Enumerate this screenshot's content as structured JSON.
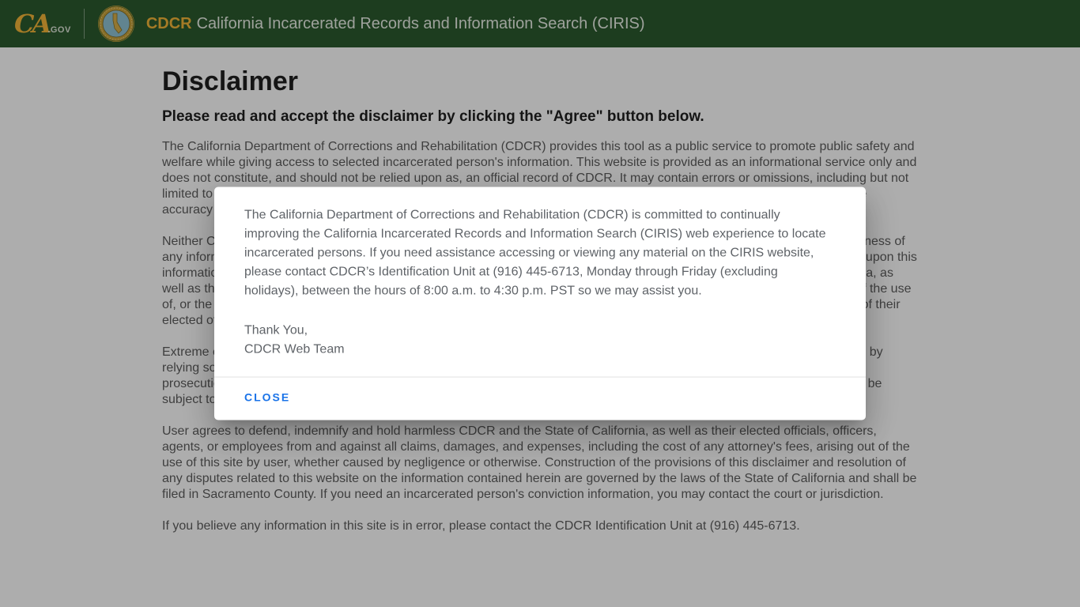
{
  "header": {
    "logo_ca": "CA",
    "logo_gov": ".GOV",
    "brand_cdcr": "CDCR",
    "brand_title": "California Incarcerated Records and Information Search (CIRIS)"
  },
  "colors": {
    "header_green": "#2c5a2e",
    "brand_gold": "#f4b639",
    "close_blue": "#1a73e8",
    "body_text_gray": "#5d5d5d",
    "modal_text_gray": "#5f6368"
  },
  "main": {
    "title": "Disclaimer",
    "subtitle": "Please read and accept the disclaimer by clicking the \"Agree\" button below.",
    "paragraphs": [
      "The California Department of Corrections and Rehabilitation (CDCR) provides this tool as a public service to promote public safety and welfare while giving access to selected incarcerated person's information. This website is provided as an informational service only and does not constitute, and should not be relied upon as, an official record of CDCR. It may contain errors or omissions, including but not limited to an incarcerated person's conviction county, admitted date and current location. CDCR makes no guarantee as to the accuracy or completeness of the information contained in this website.",
      "Neither CDCR nor the State of California assumes any liability or legal responsibility for the accuracy, completeness, or usefulness of any information provided on this website. The user shall assume all risks associated with the use of this website. Any reliance upon this information, made at the sole judgment of the user, may be incorrect, incomplete or outdated. CDCR and the State of California, as well as their elected officials, officers, agents, or employees, shall not be liable for any direct or indirect damages arising out of the use of, or the inability to use, this website. The user waives any and all claims against CDCR and the State of California, and any of their elected officials, officers, agents, or employees, arising from use of or reliance upon the information contained in this website.",
      "Extreme care should be used when utilizing the information contained in this website as positive identification cannot be made by relying solely upon names. Misuse of, or reliance upon, any of the information in this website may subject the user to criminal prosecution and/or civil liability.Unauthorized attempts to change the information in this website are strictly prohibited and may be subject to criminal prosecution and/or civil liability.",
      "User agrees to defend, indemnify and hold harmless CDCR and the State of California, as well as their elected officials, officers, agents, or employees from and against all claims, damages, and expenses, including the cost of any attorney's fees, arising out of the use of this site by user, whether caused by negligence or otherwise. Construction of the provisions of this disclaimer and resolution of any disputes related to this website on the information contained herein are governed by the laws of the State of California and shall be filed in Sacramento County. If you need an incarcerated person's conviction information, you may contact the court or jurisdiction.",
      "If you believe any information in this site is in error, please contact the CDCR Identification Unit at (916) 445-6713."
    ]
  },
  "modal": {
    "body": "The California Department of Corrections and Rehabilitation (CDCR) is committed to continually improving the California Incarcerated Records and Information Search (CIRIS) web experience to locate incarcerated persons. If you need assistance accessing or viewing any material on the CIRIS website, please contact CDCR’s Identification Unit at (916) 445-6713, Monday through Friday (excluding holidays), between the hours of 8:00 a.m. to 4:30 p.m. PST so we may assist you.",
    "signoff_line1": "Thank You,",
    "signoff_line2": "CDCR Web Team",
    "close_label": "CLOSE"
  }
}
